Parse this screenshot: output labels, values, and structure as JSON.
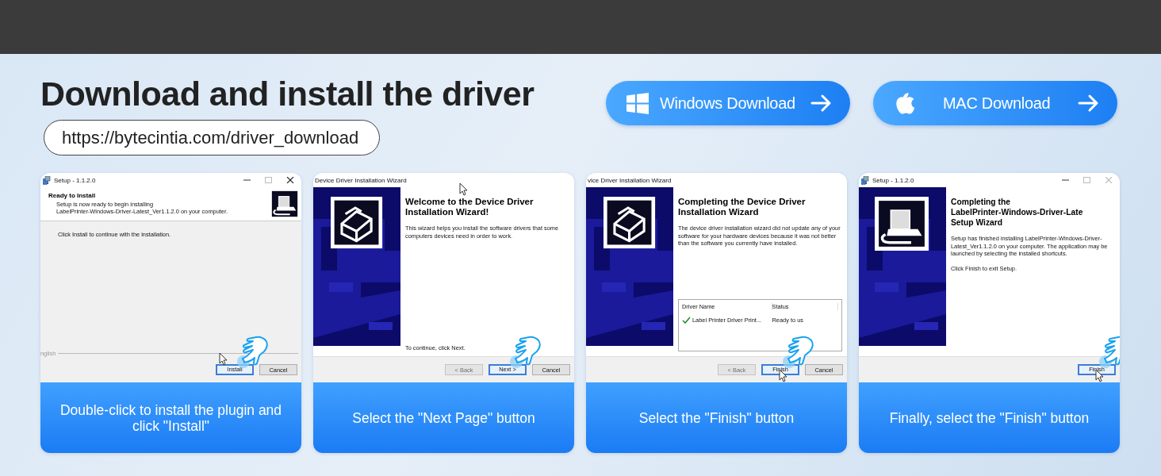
{
  "heading": "Download and install the driver",
  "url": "https://bytecintia.com/driver_download",
  "download_buttons": [
    {
      "label": "Windows Download",
      "kind": "windows"
    },
    {
      "label": "MAC Download",
      "kind": "mac"
    }
  ],
  "steps": [
    {
      "caption": "Double-click to install the plugin and click \"Install\"",
      "screen": {
        "kind": "ready",
        "title": "Setup - 1.1.2.0",
        "app_icon": true,
        "window_controls": {
          "close_enabled": true
        },
        "heading": [
          "Ready to Install"
        ],
        "body": [
          "Setup is now ready to begin installing",
          "LabelPrinter-Windows-Driver-Latest_Ver1.1.2.0 on your computer."
        ],
        "note": "Click Install to continue with the installation.",
        "language": "nglish",
        "buttons": [
          {
            "label": "Install",
            "disabled": false,
            "focused": true
          },
          {
            "label": "Cancel",
            "disabled": false,
            "focused": false
          }
        ]
      }
    },
    {
      "caption": "Select the \"Next Page\" button",
      "screen": {
        "kind": "welcome",
        "title": "Device Driver Installation Wizard",
        "app_icon": false,
        "heading": [
          "Welcome to the Device Driver",
          "Installation Wizard!"
        ],
        "body": [
          "This wizard helps you install the software drivers that some computers devices need in order to work."
        ],
        "bottom_text": "To continue, click Next.",
        "buttons": [
          {
            "label": "< Back",
            "disabled": true,
            "focused": false
          },
          {
            "label": "Next >",
            "disabled": false,
            "focused": true
          },
          {
            "label": "Cancel",
            "disabled": false,
            "focused": false
          }
        ]
      }
    },
    {
      "caption": "Select the \"Finish\" button",
      "screen": {
        "kind": "complete",
        "title": "vice Driver Installation Wizard",
        "app_icon": false,
        "heading": [
          "Completing the Device Driver",
          "Installation Wizard"
        ],
        "body": [
          "The device driver installation wizard did not update any of your software for your hardware devices because it was not better than the software you currently have installed."
        ],
        "table": {
          "columns": [
            "Driver Name",
            "Status"
          ],
          "rows": [
            {
              "checked": true,
              "cells": [
                "Label Printer Driver Print...",
                "Ready to us"
              ]
            }
          ]
        },
        "buttons": [
          {
            "label": "< Back",
            "disabled": true,
            "focused": false
          },
          {
            "label": "Finish",
            "disabled": false,
            "focused": true
          },
          {
            "label": "Cancel",
            "disabled": false,
            "focused": false
          }
        ]
      }
    },
    {
      "caption": "Finally, select the \"Finish\" button",
      "screen": {
        "kind": "finish",
        "title": "Setup - 1.1.2.0",
        "app_icon": true,
        "window_controls": {
          "close_enabled": false
        },
        "heading": [
          "Completing the",
          "LabelPrinter-Windows-Driver-Late",
          "Setup Wizard"
        ],
        "body": [
          "Setup has finished installing LabelPrinter-Windows-Driver-Latest_Ver1.1.2.0 on your computer. The application may be launched by selecting the installed shortcuts.",
          "Click Finish to exit Setup."
        ],
        "buttons": [
          {
            "label": "Finish",
            "disabled": false,
            "focused": true
          }
        ]
      }
    }
  ]
}
